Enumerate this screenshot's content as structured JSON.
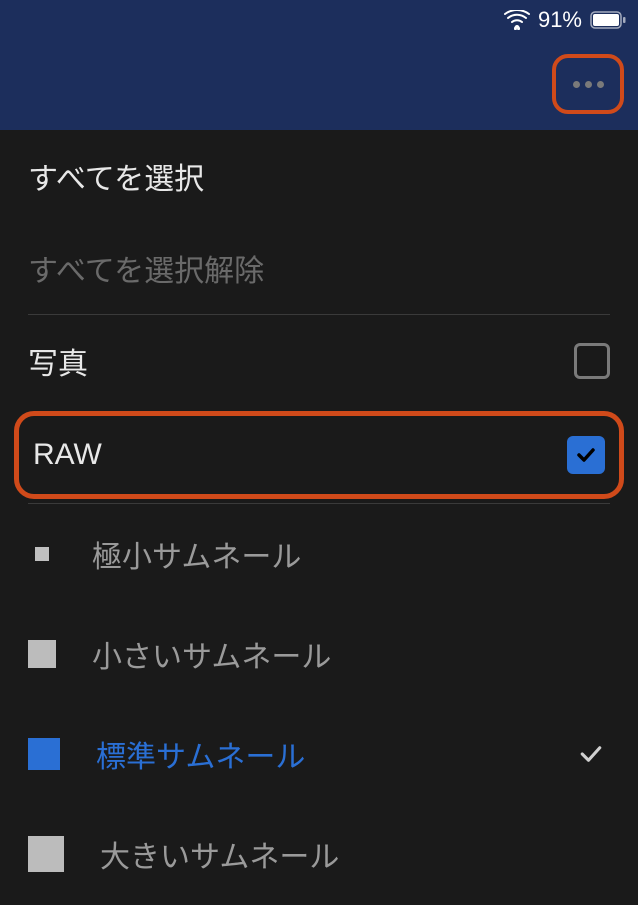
{
  "statusBar": {
    "batteryPercent": "91%"
  },
  "menu": {
    "selectAll": "すべてを選択",
    "deselectAll": "すべてを選択解除",
    "photos": {
      "label": "写真",
      "checked": false
    },
    "raw": {
      "label": "RAW",
      "checked": true
    }
  },
  "thumbnails": {
    "tiny": "極小サムネール",
    "small": "小さいサムネール",
    "medium": "標準サムネール",
    "large": "大きいサムネール",
    "selected": "medium"
  }
}
